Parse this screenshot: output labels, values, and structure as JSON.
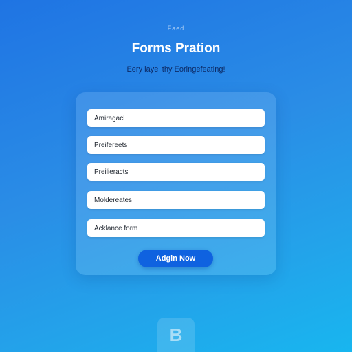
{
  "header": {
    "eyebrow": "Faed",
    "title": "Forms Pration",
    "subtitle": "Eery layel thy Eoringefeating!"
  },
  "form": {
    "fields": [
      {
        "value": "Amiragacl"
      },
      {
        "value": "Preifereets"
      },
      {
        "value": "Preilieracts"
      },
      {
        "value": "Moldereates"
      },
      {
        "value": "Acklance form"
      }
    ],
    "submit_label": "Adgin Now"
  },
  "footer": {
    "logo_mark": "B"
  },
  "colors": {
    "background_top": "#1f74e3",
    "background_bottom": "#18b6ef",
    "button": "#0f62e0",
    "subtitle_text": "#0c2a66"
  }
}
